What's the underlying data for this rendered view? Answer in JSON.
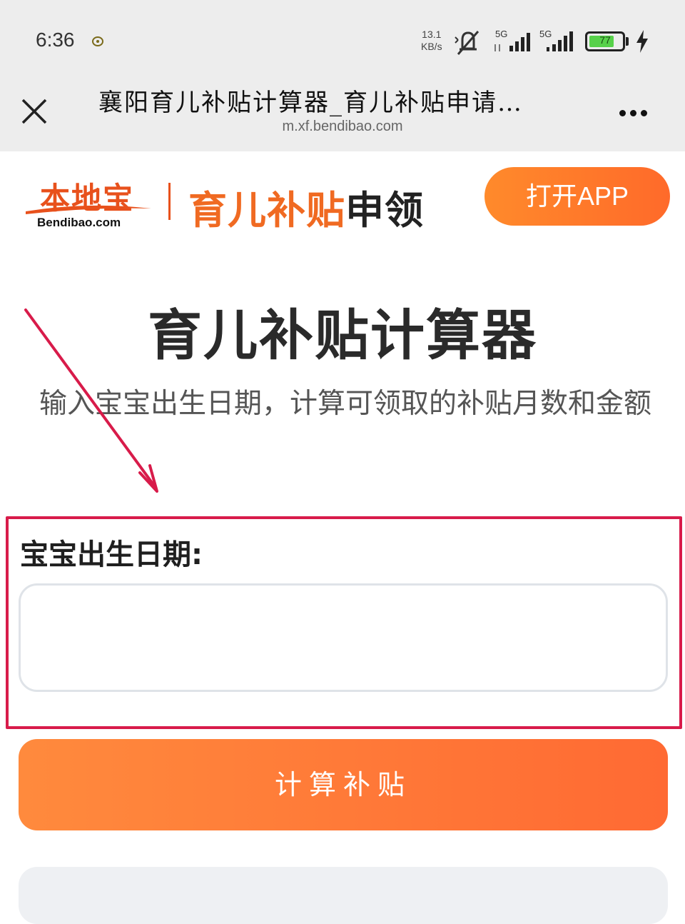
{
  "status_bar": {
    "time": "6:36",
    "net_speed_value": "13.1",
    "net_speed_unit": "KB/s",
    "signal1_label": "5G",
    "signal2_label": "5G",
    "battery_percent": "77"
  },
  "browser": {
    "page_title": "襄阳育儿补贴计算器_育儿补贴申请…",
    "url": "m.xf.bendibao.com"
  },
  "header": {
    "logo_text": "本地宝",
    "logo_subtext": "Bendibao.com",
    "site_name_highlight": "育儿补贴",
    "site_name_rest": "申领",
    "open_app_label": "打开APP"
  },
  "main": {
    "title": "育儿补贴计算器",
    "description": "输入宝宝出生日期，计算可领取的补贴月数和金额",
    "birth_date_label": "宝宝出生日期:",
    "birth_date_value": "",
    "calculate_label": "计算补贴"
  },
  "colors": {
    "brand_orange": "#ff6a2a",
    "highlight_red": "#d81b4a"
  }
}
